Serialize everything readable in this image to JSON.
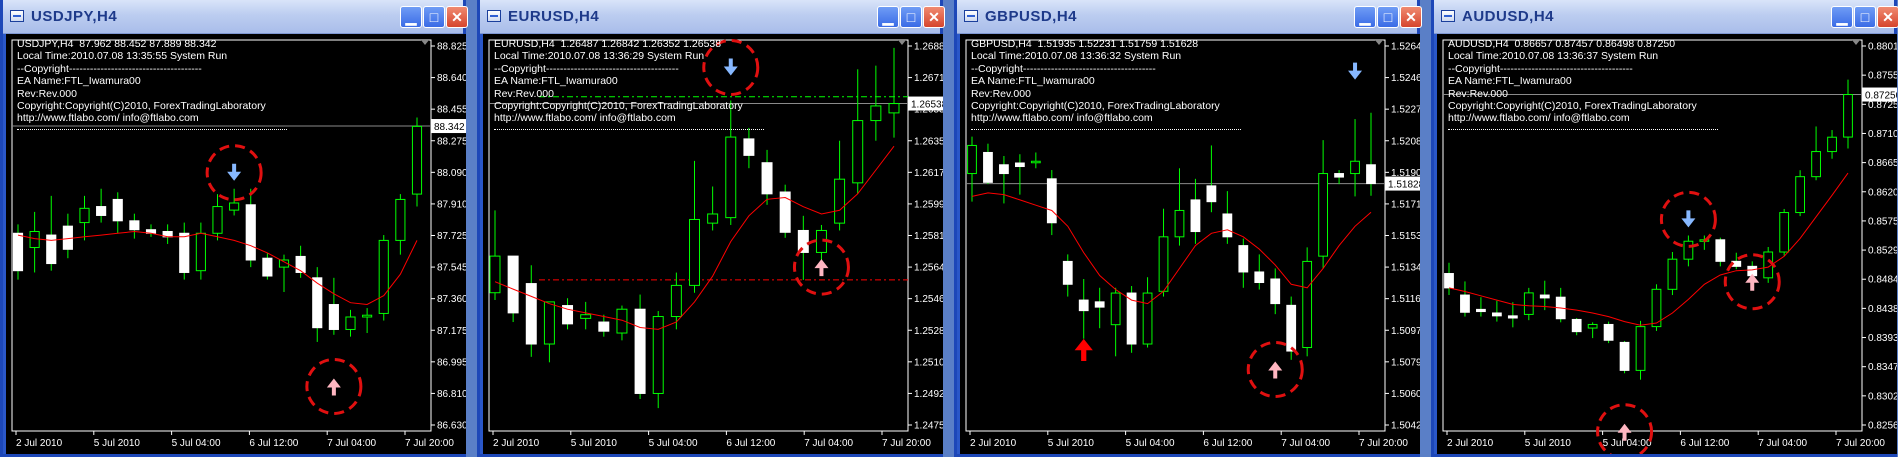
{
  "theme": {
    "bull": "#00ff00",
    "bear": "#ffffff",
    "ma": "#ff0000",
    "bg": "#000000",
    "axis": "#ffffff",
    "arrow_up_strong": "#ff0000",
    "arrow_up_light": "#ffb6c1",
    "arrow_down": "#87b8ff"
  },
  "info": {
    "copyright_header": "--Copyright--------------------------------------",
    "ea_name": "EA Name:FTL_Iwamura00",
    "rev": "Rev:Rev.000",
    "copyright_line": "Copyright:Copyright(C)2010, ForexTradingLaboratory",
    "url": "http://www.ftlabo.com/ info@ftlabo.com"
  },
  "windows": [
    {
      "title": "USDJPY,H4",
      "header": "USDJPY,H4  87.962 88.452 87.889 88.342",
      "local_time": "Local Time:2010.07.08 13:35:55 System Run",
      "price_label": "88.342",
      "buttons": {
        "minimize": "▁",
        "maximize": "□",
        "close": "✕"
      },
      "chart_data": {
        "type": "candlestick",
        "y_ticks": [
          "88.825",
          "88.640",
          "88.455",
          "88.275",
          "88.090",
          "87.910",
          "87.725",
          "87.545",
          "87.360",
          "87.175",
          "86.995",
          "86.810",
          "86.630"
        ],
        "x_ticks": [
          "2 Jul 2010",
          "5 Jul 2010",
          "5 Jul 04:00",
          "6 Jul 12:00",
          "7 Jul 04:00",
          "7 Jul 20:00"
        ],
        "ylim": [
          86.63,
          88.825
        ],
        "current_price": 88.342,
        "candles": [
          [
            87.74,
            87.79,
            87.48,
            87.53
          ],
          [
            87.66,
            87.86,
            87.52,
            87.75
          ],
          [
            87.73,
            87.95,
            87.53,
            87.57
          ],
          [
            87.78,
            87.85,
            87.6,
            87.65
          ],
          [
            87.8,
            87.95,
            87.7,
            87.88
          ],
          [
            87.89,
            87.99,
            87.8,
            87.84
          ],
          [
            87.93,
            87.97,
            87.74,
            87.81
          ],
          [
            87.81,
            87.85,
            87.71,
            87.76
          ],
          [
            87.76,
            87.79,
            87.72,
            87.74
          ],
          [
            87.75,
            87.79,
            87.68,
            87.72
          ],
          [
            87.74,
            87.8,
            87.48,
            87.52
          ],
          [
            87.53,
            87.8,
            87.48,
            87.74
          ],
          [
            87.74,
            87.96,
            87.7,
            87.89
          ],
          [
            87.87,
            87.99,
            87.84,
            87.91
          ],
          [
            87.9,
            87.99,
            87.55,
            87.59
          ],
          [
            87.6,
            87.63,
            87.48,
            87.5
          ],
          [
            87.55,
            87.62,
            87.41,
            87.59
          ],
          [
            87.61,
            87.67,
            87.49,
            87.52
          ],
          [
            87.49,
            87.55,
            87.13,
            87.21
          ],
          [
            87.34,
            87.49,
            87.17,
            87.2
          ],
          [
            87.2,
            87.31,
            87.16,
            87.27
          ],
          [
            87.27,
            87.32,
            87.18,
            87.28
          ],
          [
            87.29,
            87.73,
            87.25,
            87.7
          ],
          [
            87.7,
            87.96,
            87.62,
            87.93
          ],
          [
            87.96,
            88.39,
            87.89,
            88.34
          ]
        ],
        "ma": [
          87.73,
          87.71,
          87.7,
          87.71,
          87.72,
          87.73,
          87.74,
          87.75,
          87.74,
          87.72,
          87.72,
          87.74,
          87.72,
          87.7,
          87.67,
          87.63,
          87.58,
          87.53,
          87.46,
          87.4,
          87.35,
          87.34,
          87.39,
          87.51,
          87.7
        ],
        "markers": [
          {
            "kind": "arrow-down",
            "index": 13,
            "price": 88.08,
            "circle": true
          },
          {
            "kind": "arrow-up",
            "index": 19,
            "price": 86.88,
            "circle": true
          }
        ]
      }
    },
    {
      "title": "EURUSD,H4",
      "header": "EURUSD,H4  1.26487 1.26842 1.26352 1.26538",
      "local_time": "Local Time:2010.07.08 13:36:29 System Run",
      "price_label": "1.26538",
      "buttons": {
        "minimize": "▁",
        "maximize": "□",
        "close": "✕"
      },
      "chart_data": {
        "type": "candlestick",
        "y_ticks": [
          "1.26885",
          "1.26710",
          "1.26530",
          "1.26350",
          "1.26175",
          "1.25995",
          "1.25815",
          "1.25640",
          "1.25460",
          "1.25280",
          "1.25105",
          "1.24925",
          "1.24750"
        ],
        "x_ticks": [
          "2 Jul 2010",
          "5 Jul 2010",
          "5 Jul 04:00",
          "6 Jul 12:00",
          "7 Jul 04:00",
          "7 Jul 20:00"
        ],
        "ylim": [
          1.2475,
          1.26885
        ],
        "current_price": 1.26538,
        "dashed_levels": [
          {
            "price": 1.26575,
            "color": "#00ff00"
          },
          {
            "price": 1.25575,
            "color": "#ff0000"
          }
        ],
        "candles": [
          [
            1.25505,
            1.25955,
            1.25465,
            1.25705
          ],
          [
            1.25705,
            1.25655,
            1.25345,
            1.25395
          ],
          [
            1.25555,
            1.25655,
            1.25155,
            1.25225
          ],
          [
            1.25225,
            1.25455,
            1.25125,
            1.25455
          ],
          [
            1.25435,
            1.25475,
            1.25305,
            1.25335
          ],
          [
            1.25365,
            1.25455,
            1.25305,
            1.25385
          ],
          [
            1.25345,
            1.25385,
            1.25265,
            1.25295
          ],
          [
            1.25285,
            1.25435,
            1.25245,
            1.25415
          ],
          [
            1.25415,
            1.25495,
            1.24925,
            1.24955
          ],
          [
            1.24955,
            1.25405,
            1.24875,
            1.25375
          ],
          [
            1.25375,
            1.25615,
            1.25305,
            1.25545
          ],
          [
            1.25545,
            1.26225,
            1.25505,
            1.25905
          ],
          [
            1.25885,
            1.26085,
            1.25845,
            1.25935
          ],
          [
            1.25915,
            1.26555,
            1.25875,
            1.26355
          ],
          [
            1.26345,
            1.26405,
            1.26185,
            1.26255
          ],
          [
            1.26215,
            1.26285,
            1.25985,
            1.26045
          ],
          [
            1.26055,
            1.26095,
            1.25805,
            1.25835
          ],
          [
            1.25845,
            1.25925,
            1.25575,
            1.25725
          ],
          [
            1.25725,
            1.25875,
            1.25625,
            1.25845
          ],
          [
            1.25885,
            1.26335,
            1.25845,
            1.26125
          ],
          [
            1.26105,
            1.26725,
            1.26045,
            1.26445
          ],
          [
            1.26445,
            1.26745,
            1.26335,
            1.26525
          ],
          [
            1.26487,
            1.26842,
            1.26352,
            1.26538
          ]
        ],
        "ma": [
          1.25565,
          1.25525,
          1.25485,
          1.25445,
          1.25415,
          1.25395,
          1.25375,
          1.25355,
          1.25315,
          1.25305,
          1.25345,
          1.25455,
          1.25595,
          1.25785,
          1.25925,
          1.26015,
          1.26025,
          1.25975,
          1.25935,
          1.25955,
          1.26045,
          1.26175,
          1.26305
        ],
        "markers": [
          {
            "kind": "arrow-down",
            "index": 13,
            "price": 1.26735,
            "circle": true
          },
          {
            "kind": "arrow-up",
            "index": 18,
            "price": 1.25645,
            "circle": true
          }
        ]
      }
    },
    {
      "title": "GBPUSD,H4",
      "header": "GBPUSD,H4  1.51935 1.52231 1.51759 1.51628",
      "local_time": "Local Time:2010.07.08 13:36:32 System Run",
      "price_label": "1.51828",
      "buttons": {
        "minimize": "▁",
        "maximize": "□",
        "close": "✕"
      },
      "chart_data": {
        "type": "candlestick",
        "y_ticks": [
          "1.52645",
          "1.52460",
          "1.52270",
          "1.52085",
          "1.51900",
          "1.51715",
          "1.51530",
          "1.51345",
          "1.51160",
          "1.50975",
          "1.50790",
          "1.50605",
          "1.50420"
        ],
        "x_ticks": [
          "2 Jul 2010",
          "5 Jul 2010",
          "5 Jul 04:00",
          "6 Jul 12:00",
          "7 Jul 04:00",
          "7 Jul 20:00"
        ],
        "ylim": [
          1.5042,
          1.52645
        ],
        "current_price": 1.51828,
        "candles": [
          [
            1.51885,
            1.52095,
            1.51725,
            1.52045
          ],
          [
            1.52005,
            1.52055,
            1.51825,
            1.51835
          ],
          [
            1.51935,
            1.51985,
            1.51715,
            1.51885
          ],
          [
            1.51945,
            1.51995,
            1.51765,
            1.51925
          ],
          [
            1.51955,
            1.52005,
            1.51915,
            1.51955
          ],
          [
            1.51855,
            1.51905,
            1.51535,
            1.51605
          ],
          [
            1.51385,
            1.51425,
            1.51185,
            1.51255
          ],
          [
            1.51165,
            1.51285,
            1.50945,
            1.51105
          ],
          [
            1.51155,
            1.51235,
            1.51005,
            1.51125
          ],
          [
            1.51025,
            1.51235,
            1.50845,
            1.51205
          ],
          [
            1.51205,
            1.51245,
            1.50865,
            1.50915
          ],
          [
            1.50915,
            1.51295,
            1.50895,
            1.51205
          ],
          [
            1.51215,
            1.51685,
            1.51185,
            1.51525
          ],
          [
            1.51525,
            1.51915,
            1.51475,
            1.51675
          ],
          [
            1.51735,
            1.51855,
            1.51485,
            1.51555
          ],
          [
            1.51815,
            1.52045,
            1.51665,
            1.51725
          ],
          [
            1.51655,
            1.51785,
            1.51485,
            1.51525
          ],
          [
            1.51475,
            1.51515,
            1.51235,
            1.51325
          ],
          [
            1.51325,
            1.51425,
            1.51225,
            1.51265
          ],
          [
            1.51285,
            1.51345,
            1.51085,
            1.51145
          ],
          [
            1.51135,
            1.51185,
            1.50825,
            1.50875
          ],
          [
            1.50895,
            1.51465,
            1.50845,
            1.51385
          ],
          [
            1.51415,
            1.52075,
            1.51345,
            1.51885
          ],
          [
            1.51885,
            1.51905,
            1.51825,
            1.51865
          ],
          [
            1.51885,
            1.52195,
            1.51755,
            1.51955
          ],
          [
            1.51935,
            1.52231,
            1.51759,
            1.51828
          ]
        ],
        "ma": [
          1.51755,
          1.51775,
          1.51765,
          1.51735,
          1.51705,
          1.51675,
          1.51585,
          1.51435,
          1.51305,
          1.51225,
          1.51165,
          1.51145,
          1.51215,
          1.51345,
          1.51475,
          1.51545,
          1.51565,
          1.51525,
          1.51455,
          1.51365,
          1.51255,
          1.51235,
          1.51345,
          1.51475,
          1.51585,
          1.51665
        ],
        "markers": [
          {
            "kind": "arrow-up-strong",
            "index": 7,
            "price": 1.50885,
            "circle": false
          },
          {
            "kind": "arrow-up",
            "index": 19,
            "price": 1.5077,
            "circle": true
          },
          {
            "kind": "arrow-down",
            "index": 24,
            "price": 1.52465,
            "circle": false
          }
        ]
      }
    },
    {
      "title": "AUDUSD,H4",
      "header": "AUDUSD,H4  0.86657 0.87457 0.86498 0.87250",
      "local_time": "Local Time:2010.07.08 13:36:37 System Run",
      "price_label": "0.87250",
      "buttons": {
        "minimize": "▁",
        "maximize": "□",
        "close": "✕"
      },
      "chart_data": {
        "type": "candlestick",
        "y_ticks": [
          "0.88010",
          "0.87550",
          "0.87250",
          "0.87100",
          "0.86655",
          "0.86200",
          "0.85750",
          "0.85290",
          "0.84840",
          "0.84380",
          "0.83930",
          "0.83470",
          "0.83020",
          "0.82560"
        ],
        "x_ticks": [
          "2 Jul 2010",
          "5 Jul 2010",
          "5 Jul 04:00",
          "6 Jul 12:00",
          "7 Jul 04:00",
          "7 Jul 20:00"
        ],
        "ylim": [
          0.8256,
          0.8801
        ],
        "current_price": 0.8725,
        "candles": [
          [
            0.84755,
            0.84905,
            0.84455,
            0.84555
          ],
          [
            0.84455,
            0.84645,
            0.84155,
            0.84215
          ],
          [
            0.84255,
            0.84425,
            0.84155,
            0.84225
          ],
          [
            0.84205,
            0.84375,
            0.84085,
            0.84165
          ],
          [
            0.84165,
            0.84355,
            0.84005,
            0.84135
          ],
          [
            0.84185,
            0.84555,
            0.84105,
            0.84485
          ],
          [
            0.84455,
            0.84655,
            0.84245,
            0.84415
          ],
          [
            0.84425,
            0.84555,
            0.84075,
            0.84125
          ],
          [
            0.84115,
            0.84135,
            0.83895,
            0.83945
          ],
          [
            0.83995,
            0.84075,
            0.83855,
            0.84045
          ],
          [
            0.84045,
            0.84085,
            0.83785,
            0.83825
          ],
          [
            0.83795,
            0.83815,
            0.83365,
            0.83405
          ],
          [
            0.83405,
            0.84095,
            0.83275,
            0.84015
          ],
          [
            0.84015,
            0.84605,
            0.83955,
            0.84535
          ],
          [
            0.84535,
            0.85055,
            0.84455,
            0.84955
          ],
          [
            0.84955,
            0.85285,
            0.84855,
            0.85205
          ],
          [
            0.85205,
            0.85285,
            0.85085,
            0.85225
          ],
          [
            0.85225,
            0.85255,
            0.84855,
            0.84925
          ],
          [
            0.84925,
            0.85045,
            0.84815,
            0.84855
          ],
          [
            0.84855,
            0.84925,
            0.84695,
            0.84725
          ],
          [
            0.84695,
            0.85125,
            0.84625,
            0.85055
          ],
          [
            0.85055,
            0.85655,
            0.85005,
            0.85605
          ],
          [
            0.85605,
            0.86195,
            0.85555,
            0.86105
          ],
          [
            0.86105,
            0.86805,
            0.86055,
            0.86455
          ],
          [
            0.86455,
            0.86755,
            0.86355,
            0.86655
          ],
          [
            0.86657,
            0.87457,
            0.86498,
            0.8725
          ]
        ],
        "ma": [
          0.84555,
          0.84505,
          0.84445,
          0.84385,
          0.84325,
          0.84305,
          0.84295,
          0.84275,
          0.84245,
          0.84205,
          0.84155,
          0.84085,
          0.84035,
          0.84065,
          0.84205,
          0.84395,
          0.84605,
          0.84735,
          0.84795,
          0.84805,
          0.84845,
          0.84995,
          0.85245,
          0.85545,
          0.85845,
          0.86155
        ],
        "markers": [
          {
            "kind": "arrow-down",
            "index": 15,
            "price": 0.8551,
            "circle": true
          },
          {
            "kind": "arrow-up",
            "index": 19,
            "price": 0.8464,
            "circle": true
          },
          {
            "kind": "arrow-up",
            "index": 11,
            "price": 0.8255,
            "circle": true
          }
        ]
      }
    }
  ]
}
